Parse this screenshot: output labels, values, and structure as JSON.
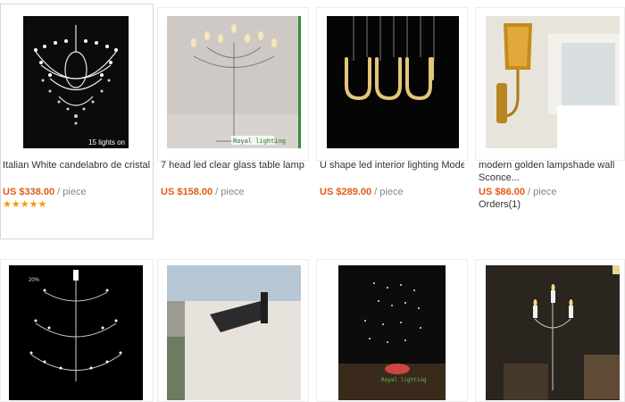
{
  "products": [
    {
      "title": "Italian White candelabro de cristal...",
      "price": "US $338.00",
      "unit": "/ piece",
      "rating_stars": "★★★★★",
      "overlay": "15 lights on"
    },
    {
      "title": "7 head led clear glass table lamp...",
      "price": "US $158.00",
      "unit": "/ piece",
      "overlay": "Royal lighting"
    },
    {
      "title": "U shape led interior lighting Modern...",
      "price": "US $289.00",
      "unit": "/ piece"
    },
    {
      "title_line1": "modern golden lampshade wall",
      "title_line2": "Sconce...",
      "price": "US $86.00",
      "unit": "/ piece",
      "orders": "Orders(1)"
    },
    {
      "overlay": "20%"
    },
    {},
    {
      "overlay": "Royal lighting"
    },
    {}
  ],
  "colors": {
    "price": "#e05c12",
    "star": "#f49a00",
    "border": "#ececec"
  }
}
